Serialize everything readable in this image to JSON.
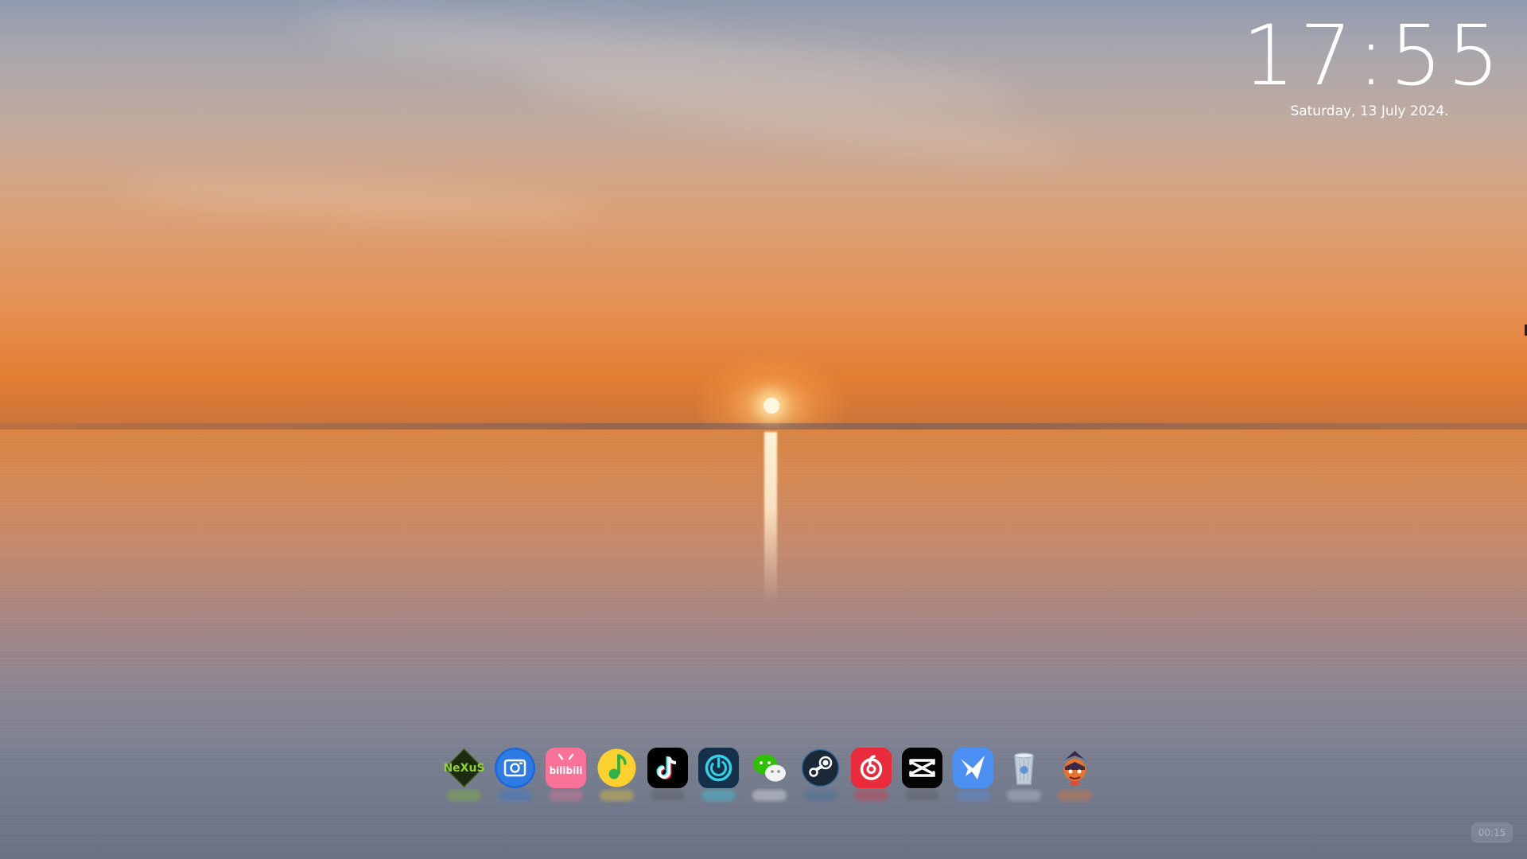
{
  "clock": {
    "time": "17:55",
    "date": "Saturday, 13 July 2024."
  },
  "dock": {
    "apps": [
      {
        "name": "nexus",
        "label": "NeXuS",
        "icon": "nexus-icon",
        "color": "#7ec423"
      },
      {
        "name": "screenshot",
        "label": "",
        "icon": "camera-icon",
        "color": "#2d7be3"
      },
      {
        "name": "bilibili",
        "label": "bilibili",
        "icon": "bilibili-icon",
        "color": "#fb7299"
      },
      {
        "name": "qq-music",
        "label": "",
        "icon": "music-note-icon",
        "color": "#ffd12e"
      },
      {
        "name": "tiktok",
        "label": "",
        "icon": "tiktok-icon",
        "color": "#000000"
      },
      {
        "name": "power-app",
        "label": "",
        "icon": "power-ring-icon",
        "color": "#12324a"
      },
      {
        "name": "wechat",
        "label": "",
        "icon": "wechat-icon",
        "color": "#2dc100"
      },
      {
        "name": "steam",
        "label": "",
        "icon": "steam-icon",
        "color": "#1b2838"
      },
      {
        "name": "netease-music",
        "label": "",
        "icon": "netease-music-icon",
        "color": "#e60026"
      },
      {
        "name": "capcut",
        "label": "",
        "icon": "capcut-icon",
        "color": "#000000"
      },
      {
        "name": "feishu",
        "label": "",
        "icon": "paper-plane-icon",
        "color": "#3370ff"
      },
      {
        "name": "trash",
        "label": "",
        "icon": "trash-icon",
        "color": "#c8d4e0"
      },
      {
        "name": "game",
        "label": "",
        "icon": "game-character-icon",
        "color": "#3a2a4a"
      }
    ]
  },
  "watermark": {
    "text": "00:15"
  }
}
